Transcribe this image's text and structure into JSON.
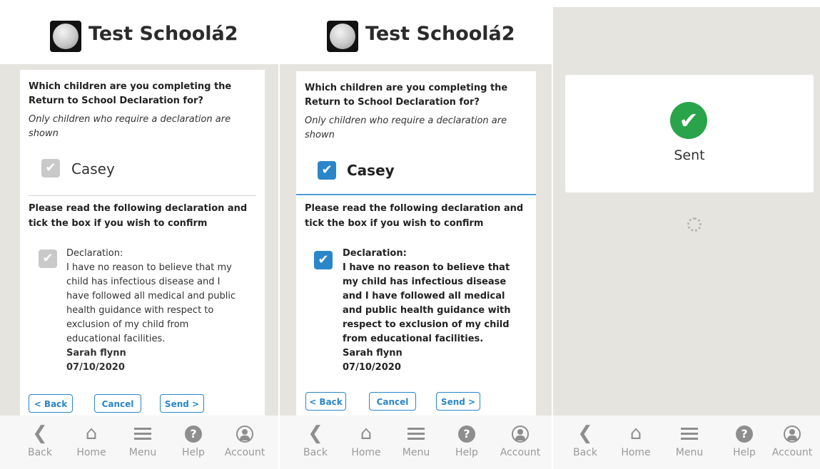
{
  "app": {
    "title": "Test Schoolá2"
  },
  "form": {
    "question": "Which children are you completing the Return to School Declaration for?",
    "note": "Only children who require a declaration are shown",
    "child_name": "Casey",
    "instruction": "Please read the following declaration and tick the box if you wish to confirm",
    "declaration_heading": "Declaration:",
    "declaration_text": "I have no reason to believe that my child has infectious disease and I have followed all medical and public health guidance with respect to exclusion of my child from educational facilities.",
    "signature_name": "Sarah flynn",
    "signature_date": "07/10/2020",
    "back_label": "< Back",
    "cancel_label": "Cancel",
    "send_label": "Send >"
  },
  "confirmation": {
    "sent_label": "Sent"
  },
  "nav": {
    "items": [
      {
        "label": "Back",
        "icon": "chevron-left-icon"
      },
      {
        "label": "Home",
        "icon": "home-icon"
      },
      {
        "label": "Menu",
        "icon": "menu-icon"
      },
      {
        "label": "Help",
        "icon": "help-icon"
      },
      {
        "label": "Account",
        "icon": "account-icon"
      }
    ]
  },
  "colors": {
    "accent": "#2a86c9",
    "success": "#2aa44a",
    "background": "#e6e4df",
    "checkbox_disabled": "#c9c9c9"
  },
  "state": {
    "panel1_checkboxes": "unchecked",
    "panel2_checkboxes": "checked"
  }
}
